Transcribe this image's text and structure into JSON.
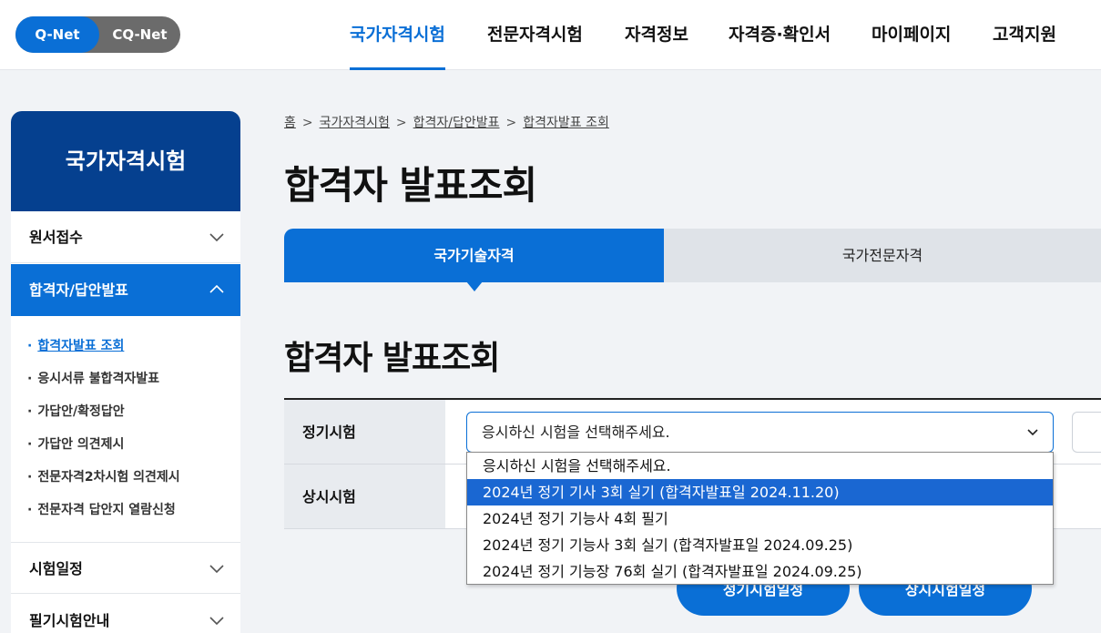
{
  "header": {
    "toggle": {
      "qnet": "Q-Net",
      "cqnet": "CQ-Net"
    },
    "nav": [
      "국가자격시험",
      "전문자격시험",
      "자격정보",
      "자격증·확인서",
      "마이페이지",
      "고객지원"
    ],
    "active_nav_index": 0
  },
  "sidebar": {
    "title": "국가자격시험",
    "items": [
      "원서접수",
      "합격자/답안발표",
      "시험일정",
      "필기시험안내"
    ],
    "active_item_index": 1,
    "sub_items": [
      "합격자발표 조회",
      "응시서류 불합격자발표",
      "가답안/확정답안",
      "가답안 의견제시",
      "전문자격2차시험 의견제시",
      "전문자격 답안지 열람신청"
    ],
    "active_sub_index": 0,
    "bullet": "·"
  },
  "breadcrumb": [
    "홈",
    "국가자격시험",
    "합격자/답안발표",
    "합격자발표 조회"
  ],
  "breadcrumb_sep": ">",
  "page_title": "합격자 발표조회",
  "tabs": [
    "국가기술자격",
    "국가전문자격"
  ],
  "active_tab_index": 0,
  "section_title": "합격자 발표조회",
  "table": {
    "rows": [
      "정기시험",
      "상시시험"
    ]
  },
  "select": {
    "value": "응시하신 시험을 선택해주세요.",
    "options": [
      "응시하신 시험을 선택해주세요.",
      "2024년 정기 기사 3회 실기 (합격자발표일 2024.11.20)",
      "2024년 정기 기능사 4회 필기",
      "2024년 정기 기능사 3회 실기 (합격자발표일 2024.09.25)",
      "2024년 정기 기능장 76회 실기 (합격자발표일 2024.09.25)"
    ],
    "highlighted_index": 1
  },
  "buttons": [
    "정기시험일정",
    "상시시험일정"
  ],
  "colors": {
    "primary": "#0a6fd6",
    "sidebar_title": "#05408f",
    "highlight": "#1a67d2"
  }
}
